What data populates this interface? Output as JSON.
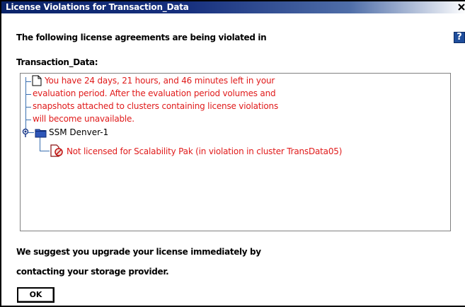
{
  "window": {
    "title": "License Violations for Transaction_Data",
    "help_symbol": "?"
  },
  "message": {
    "line1": "The following license agreements are being violated in",
    "line2": "Transaction_Data:"
  },
  "tree": {
    "warning_lines": [
      "You have 24 days, 21 hours, and 46 minutes left in your",
      "evaluation period. After the evaluation period volumes and",
      "snapshots attached to clusters containing license violations",
      "will become unavailable."
    ],
    "node": {
      "label": "SSM Denver-1",
      "icon": "folder-icon",
      "child": {
        "label": "Not licensed for Scalability Pak (in violation in cluster TransData05)",
        "icon": "license-violation-icon"
      }
    },
    "warning_icon": "document-icon"
  },
  "footer": {
    "line1": "We suggest you upgrade your license immediately by",
    "line2": "contacting your storage provider."
  },
  "ok_label": "OK",
  "colors": {
    "titlebar": "#0a246a",
    "warning_text": "#e01b1b",
    "tree_lines": "#3a6fb0",
    "help_icon": "#1f4e9c"
  }
}
